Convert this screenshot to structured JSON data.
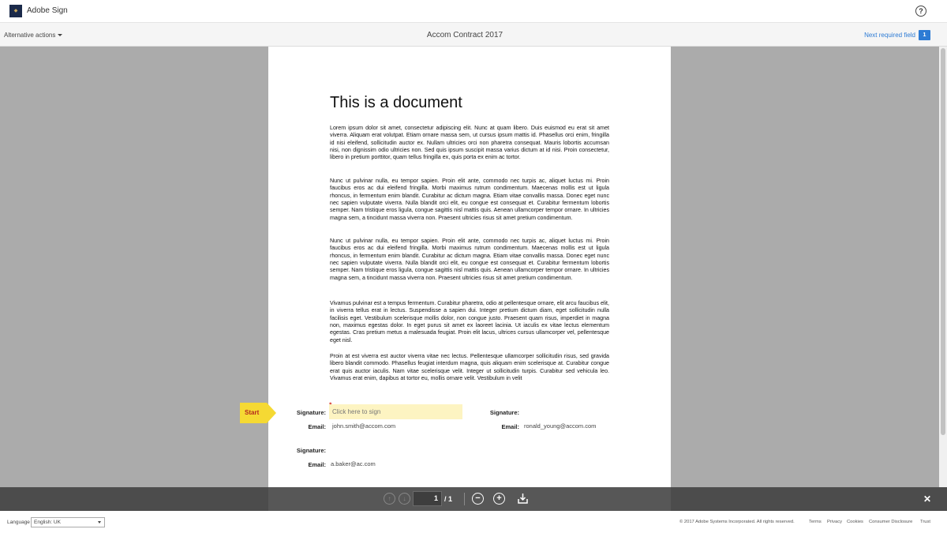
{
  "app": {
    "name": "Adobe Sign",
    "logo_text": "ADOBE"
  },
  "header": {
    "help_label": "?",
    "alternative_actions": "Alternative actions",
    "document_title": "Accom Contract 2017",
    "next_required_field": "Next required field",
    "required_count": "1"
  },
  "document": {
    "heading": "This is a document",
    "paragraphs": [
      "Lorem ipsum dolor sit amet, consectetur adipiscing elit. Nunc at quam libero. Duis euismod eu erat sit amet viverra. Aliquam erat volutpat. Etiam ornare massa sem, ut cursus ipsum mattis id. Phasellus orci enim, fringilla id nisi eleifend, sollicitudin auctor ex. Nullam ultricies orci non pharetra consequat. Mauris lobortis accumsan nisi, non dignissim odio ultricies non. Sed quis ipsum suscipit massa varius dictum at id nisi. Proin consectetur, libero in pretium porttitor, quam tellus fringilla ex, quis porta ex enim ac tortor.",
      "Nunc ut pulvinar nulla, eu tempor sapien. Proin elit ante, commodo nec turpis ac, aliquet luctus mi. Proin faucibus eros ac dui eleifend fringilla. Morbi maximus rutrum condimentum. Maecenas mollis est ut ligula rhoncus, in fermentum enim blandit. Curabitur ac dictum magna. Etiam vitae convallis massa. Donec eget nunc nec sapien vulputate viverra. Nulla blandit orci elit, eu congue est consequat et. Curabitur fermentum lobortis semper. Nam tristique eros ligula, congue sagittis nisl mattis quis. Aenean ullamcorper tempor ornare. In ultricies magna sem, a tincidunt massa viverra non. Praesent ultricies risus sit amet pretium condimentum.",
      "Nunc ut pulvinar nulla, eu tempor sapien. Proin elit ante, commodo nec turpis ac, aliquet luctus mi. Proin faucibus eros ac dui eleifend fringilla. Morbi maximus rutrum condimentum. Maecenas mollis est ut ligula rhoncus, in fermentum enim blandit. Curabitur ac dictum magna. Etiam vitae convallis massa. Donec eget nunc nec sapien vulputate viverra. Nulla blandit orci elit, eu congue est consequat et. Curabitur fermentum lobortis semper. Nam tristique eros ligula, congue sagittis nisl mattis quis. Aenean ullamcorper tempor ornare. In ultricies magna sem, a tincidunt massa viverra non. Praesent ultricies risus sit amet pretium condimentum.",
      "Vivamus pulvinar est a tempus fermentum. Curabitur pharetra, odio at pellentesque ornare, elit arcu faucibus elit, in viverra tellus erat in lectus. Suspendisse a sapien dui. Integer pretium dictum diam, eget sollicitudin nulla facilisis eget. Vestibulum scelerisque mollis dolor, non congue justo. Praesent quam risus, imperdiet in magna non, maximus egestas dolor. In eget purus sit amet ex laoreet lacinia. Ut iaculis ex vitae lectus elementum egestas. Cras pretium metus a malesuada feugiat. Proin elit lacus, ultrices cursus ullamcorper vel, pellentesque eget nisl.",
      "Proin at est viverra est auctor viverra vitae nec lectus. Pellentesque ullamcorper sollicitudin risus, sed gravida libero blandit commodo. Phasellus feugiat interdum magna, quis aliquam enim scelerisque at. Curabitur congue erat quis auctor iaculis. Nam vitae scelerisque velit. Integer ut sollicitudin turpis. Curabitur sed vehicula leo. Vivamus erat enim, dapibus at tortor eu, mollis ornare velit. Vestibulum in velit"
    ],
    "signature_label": "Signature:",
    "email_label": "Email:",
    "sign_placeholder": "Click here to sign",
    "required_marker": "*",
    "signers": [
      {
        "email": "john.smith@accom.com"
      },
      {
        "email": "ronald_young@accom.com"
      },
      {
        "email": "a.baker@ac.com"
      }
    ]
  },
  "start_flag": {
    "label": "Start"
  },
  "toolbar": {
    "prev_icon": "arrow-up-icon",
    "next_icon": "arrow-down-icon",
    "current_page": "1",
    "total_pages": "/ 1",
    "zoom_out": "−",
    "zoom_in": "+",
    "close": "✕"
  },
  "footer": {
    "language_label": "Language",
    "language_value": "English: UK",
    "copyright": "© 2017 Adobe Systems Incorporated. All rights reserved.",
    "links": [
      "Terms",
      "Privacy",
      "Cookies",
      "Consumer Disclosure",
      "Trust"
    ]
  },
  "colors": {
    "accent": "#2d7bd4",
    "start_flag": "#f5d933",
    "sign_field": "#fdf4c2",
    "toolbar": "#4c4c4c"
  }
}
